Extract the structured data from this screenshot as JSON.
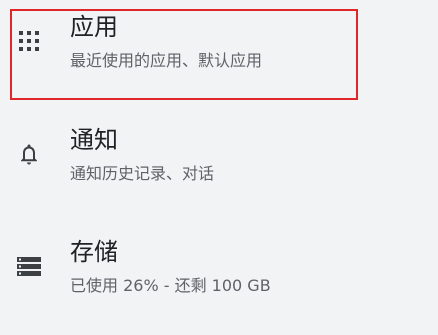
{
  "items": [
    {
      "title": "应用",
      "subtitle": "最近使用的应用、默认应用",
      "icon": "apps-grid-icon"
    },
    {
      "title": "通知",
      "subtitle": "通知历史记录、对话",
      "icon": "bell-icon"
    },
    {
      "title": "存储",
      "subtitle": "已使用 26% - 还剩 100 GB",
      "icon": "storage-icon"
    }
  ],
  "colors": {
    "background": "#f1f3f4",
    "highlight": "#e0252b",
    "title": "#202124",
    "subtitle": "#5f6368",
    "icon": "#3c4043"
  }
}
